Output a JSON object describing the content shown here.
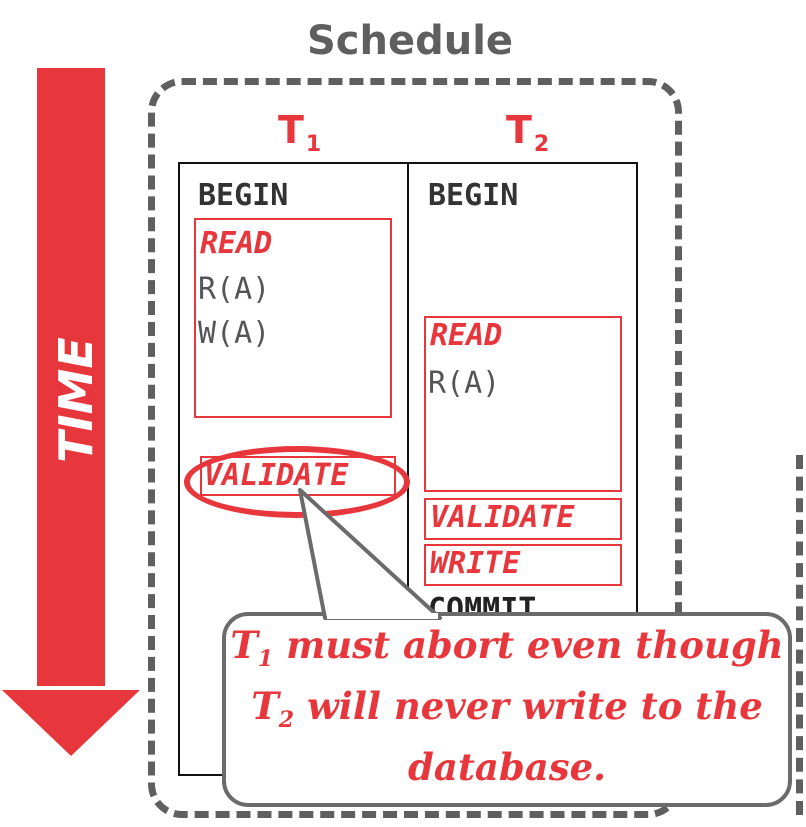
{
  "title": "Schedule",
  "arrow_label": "TIME",
  "transactions": [
    {
      "name": "T",
      "sub": "1"
    },
    {
      "name": "T",
      "sub": "2"
    }
  ],
  "t1": {
    "begin": "BEGIN",
    "read_phase": "READ",
    "ops": [
      "R(A)",
      "W(A)"
    ],
    "validate_phase": "VALIDATE"
  },
  "t2": {
    "begin": "BEGIN",
    "read_phase": "READ",
    "ops": [
      "R(A)"
    ],
    "validate_phase": "VALIDATE",
    "write_phase": "WRITE",
    "commit": "COMMIT"
  },
  "callout": {
    "line1_pre": "T",
    "line1_sub": "1",
    "line1_post": " must abort even though",
    "line2_pre": "T",
    "line2_sub": "2",
    "line2_post": " will never write to the",
    "line3": "database."
  },
  "colors": {
    "accent": "#e8373c",
    "border_gray": "#5f5f5f",
    "text_gray": "#555555"
  }
}
